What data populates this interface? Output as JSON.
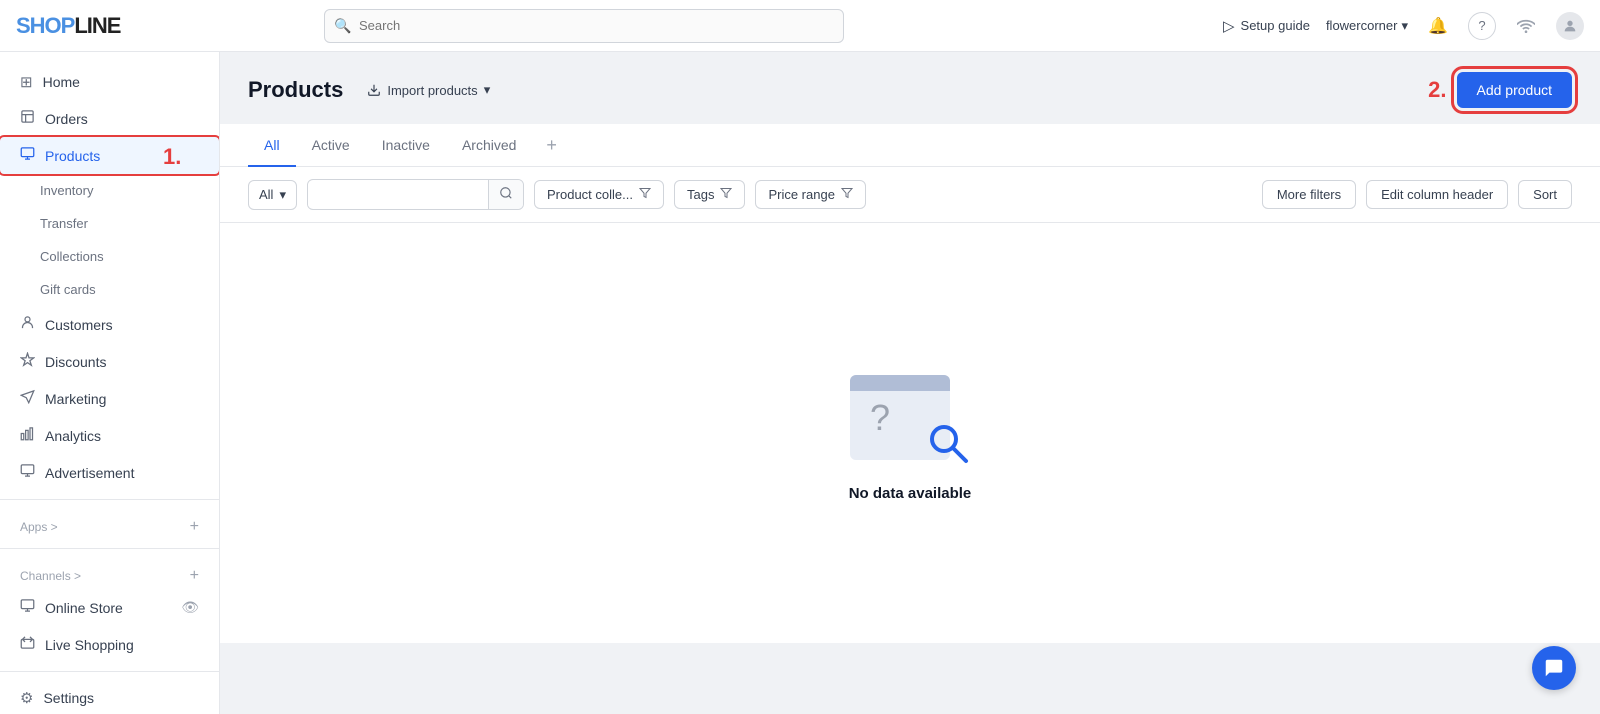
{
  "topnav": {
    "logo_shop": "SHOP",
    "logo_line": "LINE",
    "search_placeholder": "Search",
    "setup_guide_label": "Setup guide",
    "store_name": "flowercorner",
    "notification_icon": "🔔",
    "help_icon": "?",
    "wifi_icon": "wifi"
  },
  "sidebar": {
    "items": [
      {
        "id": "home",
        "label": "Home",
        "icon": "⊞"
      },
      {
        "id": "orders",
        "label": "Orders",
        "icon": "≡"
      },
      {
        "id": "products",
        "label": "Products",
        "icon": "🛍",
        "active": true
      },
      {
        "id": "inventory",
        "label": "Inventory",
        "sub": true
      },
      {
        "id": "transfer",
        "label": "Transfer",
        "sub": true
      },
      {
        "id": "collections",
        "label": "Collections",
        "sub": true
      },
      {
        "id": "gift-cards",
        "label": "Gift cards",
        "sub": true
      },
      {
        "id": "customers",
        "label": "Customers",
        "icon": "👤"
      },
      {
        "id": "discounts",
        "label": "Discounts",
        "icon": "◇"
      },
      {
        "id": "marketing",
        "label": "Marketing",
        "icon": "📢"
      },
      {
        "id": "analytics",
        "label": "Analytics",
        "icon": "📊"
      },
      {
        "id": "advertisement",
        "label": "Advertisement",
        "icon": "🖥"
      }
    ],
    "apps_label": "Apps >",
    "channels_label": "Channels >",
    "online_store_label": "Online Store",
    "live_shopping_label": "Live Shopping",
    "settings_label": "Settings",
    "settings_icon": "⚙"
  },
  "page": {
    "title": "Products",
    "import_label": "Import products",
    "annotation_1": "1.",
    "annotation_2": "2.",
    "add_product_label": "Add product"
  },
  "tabs": [
    {
      "id": "all",
      "label": "All",
      "active": true
    },
    {
      "id": "active",
      "label": "Active"
    },
    {
      "id": "inactive",
      "label": "Inactive"
    },
    {
      "id": "archived",
      "label": "Archived"
    }
  ],
  "filters": {
    "all_select": "All",
    "product_collection": "Product colle...",
    "tags": "Tags",
    "price_range": "Price range",
    "more_filters": "More filters",
    "edit_column_header": "Edit column header",
    "sort": "Sort",
    "search_placeholder": ""
  },
  "empty_state": {
    "text": "No data available"
  },
  "chat": {
    "icon": "💬"
  }
}
